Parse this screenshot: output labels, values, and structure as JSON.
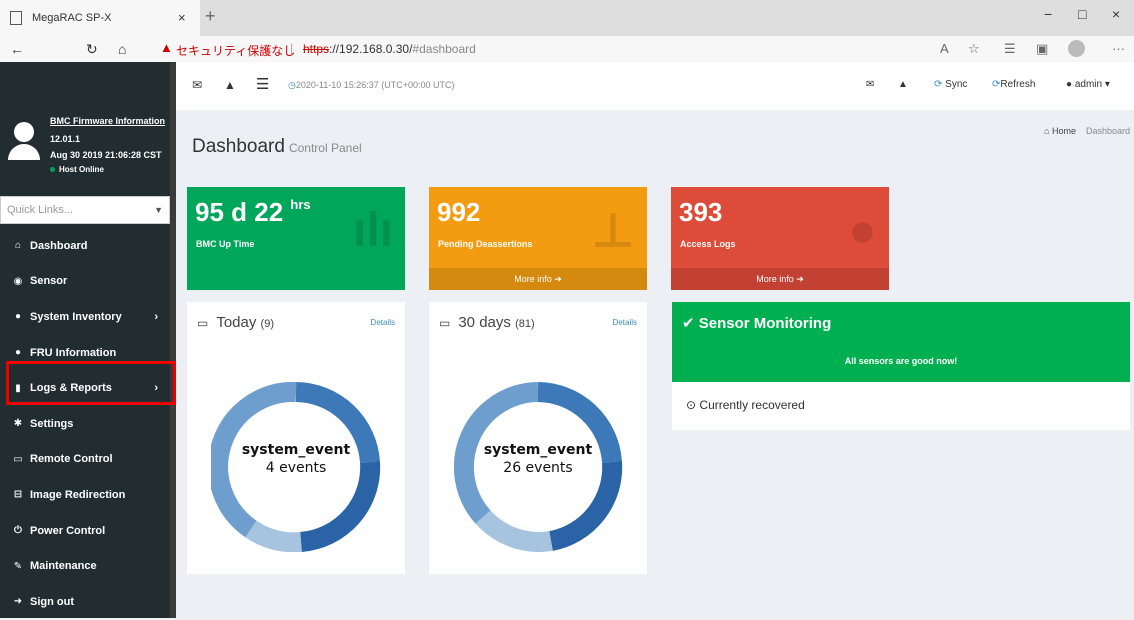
{
  "browser": {
    "tab_title": "MegaRAC SP-X",
    "tab_close": "×",
    "new_tab": "+",
    "win_min": "−",
    "win_max": "□",
    "win_close": "×",
    "security_warning": "セキュリティ保護なし",
    "url_protocol": "https",
    "url_host": "://192.168.0.30/",
    "url_path": "#dashboard",
    "icons": [
      "back-icon",
      "refresh-icon",
      "home-icon",
      "read-aloud-icon",
      "favorite-icon",
      "favorites-list-icon",
      "collections-icon",
      "profile-icon",
      "more-icon"
    ]
  },
  "sidebar": {
    "fw_title": "BMC Firmware Information",
    "fw_version": "12.01.1",
    "fw_date": "Aug 30 2019 21:06:28 CST",
    "host_status": "Host Online",
    "quick_links_placeholder": "Quick Links...",
    "items": [
      {
        "label": "Dashboard",
        "icon": "home-icon",
        "has_sub": false
      },
      {
        "label": "Sensor",
        "icon": "sensor-icon",
        "has_sub": false
      },
      {
        "label": "System Inventory",
        "icon": "info-icon",
        "has_sub": true
      },
      {
        "label": "FRU Information",
        "icon": "info-icon",
        "has_sub": false
      },
      {
        "label": "Logs & Reports",
        "icon": "chart-icon",
        "has_sub": true
      },
      {
        "label": "Settings",
        "icon": "gear-icon",
        "has_sub": false
      },
      {
        "label": "Remote Control",
        "icon": "monitor-icon",
        "has_sub": false
      },
      {
        "label": "Image Redirection",
        "icon": "disk-icon",
        "has_sub": false
      },
      {
        "label": "Power Control",
        "icon": "power-icon",
        "has_sub": false
      },
      {
        "label": "Maintenance",
        "icon": "wrench-icon",
        "has_sub": false
      },
      {
        "label": "Sign out",
        "icon": "signout-icon",
        "has_sub": false
      }
    ]
  },
  "header": {
    "datetime": "2020-11-10 15:26:37 (UTC+00:00 UTC)",
    "sync": "Sync",
    "refresh": "Refresh",
    "user": "admin"
  },
  "page": {
    "title": "Dashboard",
    "subtitle": "Control Panel",
    "breadcrumb_home": "Home",
    "breadcrumb_current": "Dashboard"
  },
  "boxes": {
    "uptime": {
      "value": "95 d 22",
      "unit": "hrs",
      "label": "BMC Up Time",
      "color": "#00a65a"
    },
    "deassertions": {
      "value": "992",
      "label": "Pending Deassertions",
      "more": "More info",
      "color": "#f39c12"
    },
    "access": {
      "value": "393",
      "label": "Access Logs",
      "more": "More info",
      "color": "#dd4b39"
    }
  },
  "today": {
    "title": "Today",
    "count": "(9)",
    "details": "Details",
    "event": "system_event",
    "events": "4 events"
  },
  "month": {
    "title": "30 days",
    "count": "(81)",
    "details": "Details",
    "event": "system_event",
    "events": "26 events"
  },
  "sensor": {
    "title": "Sensor Monitoring",
    "message": "All sensors are good now!",
    "recovered": "Currently recovered",
    "color": "#00b050"
  }
}
